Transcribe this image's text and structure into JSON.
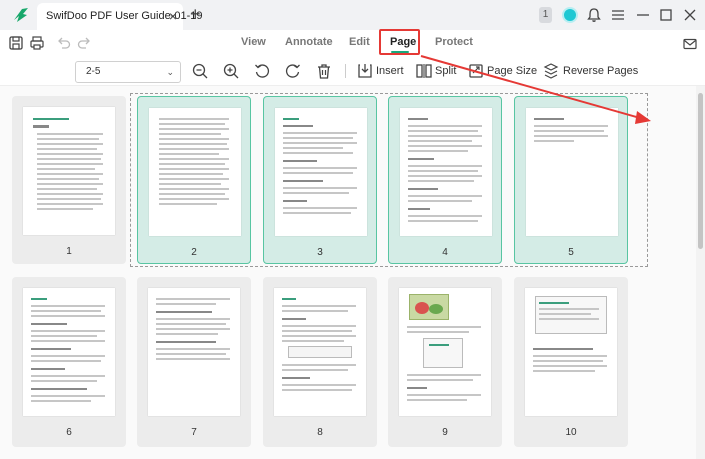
{
  "app": {
    "tab_title": "SwifDoo PDF User Guide-01-19",
    "notification_count": "1"
  },
  "menu": {
    "items": [
      "View",
      "Annotate",
      "Edit",
      "Page",
      "Protect"
    ],
    "active": "Page"
  },
  "toolbar": {
    "page_range": "2-5",
    "insert_label": "Insert",
    "split_label": "Split",
    "page_size_label": "Page Size",
    "reverse_label": "Reverse Pages"
  },
  "pages": [
    {
      "number": "1",
      "selected": false
    },
    {
      "number": "2",
      "selected": true
    },
    {
      "number": "3",
      "selected": true
    },
    {
      "number": "4",
      "selected": true
    },
    {
      "number": "5",
      "selected": true
    },
    {
      "number": "6",
      "selected": false
    },
    {
      "number": "7",
      "selected": false
    },
    {
      "number": "8",
      "selected": false
    },
    {
      "number": "9",
      "selected": false
    },
    {
      "number": "10",
      "selected": false
    }
  ],
  "colors": {
    "accent": "#1aa97c",
    "selection_fill": "#d4ece6",
    "annotation_red": "#e53935"
  }
}
